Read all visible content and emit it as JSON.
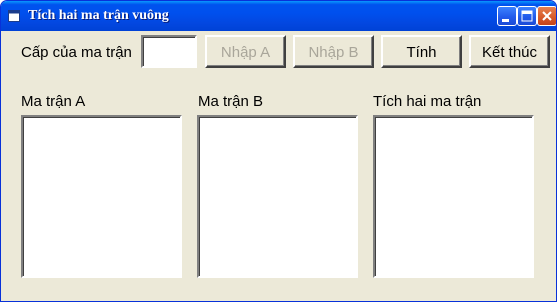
{
  "window": {
    "title": "Tích hai ma trận vuông",
    "icon": "app-window-icon",
    "controls": [
      "minimize-icon",
      "maximize-icon",
      "close-icon"
    ]
  },
  "form": {
    "size_label": "Cấp của ma trận",
    "size_value": "",
    "buttons": {
      "input_a": "Nhập A",
      "input_b": "Nhập B",
      "compute": "Tính",
      "exit": "Kết thúc"
    },
    "matrix_a_label": "Ma trận A",
    "matrix_b_label": "Ma trận B",
    "product_label": "Tích hai ma trận"
  },
  "colors": {
    "titlebar": "#0053ee",
    "face": "#ece9d8",
    "disabled_text": "#a9a69a",
    "close_button": "#d85c2c"
  }
}
